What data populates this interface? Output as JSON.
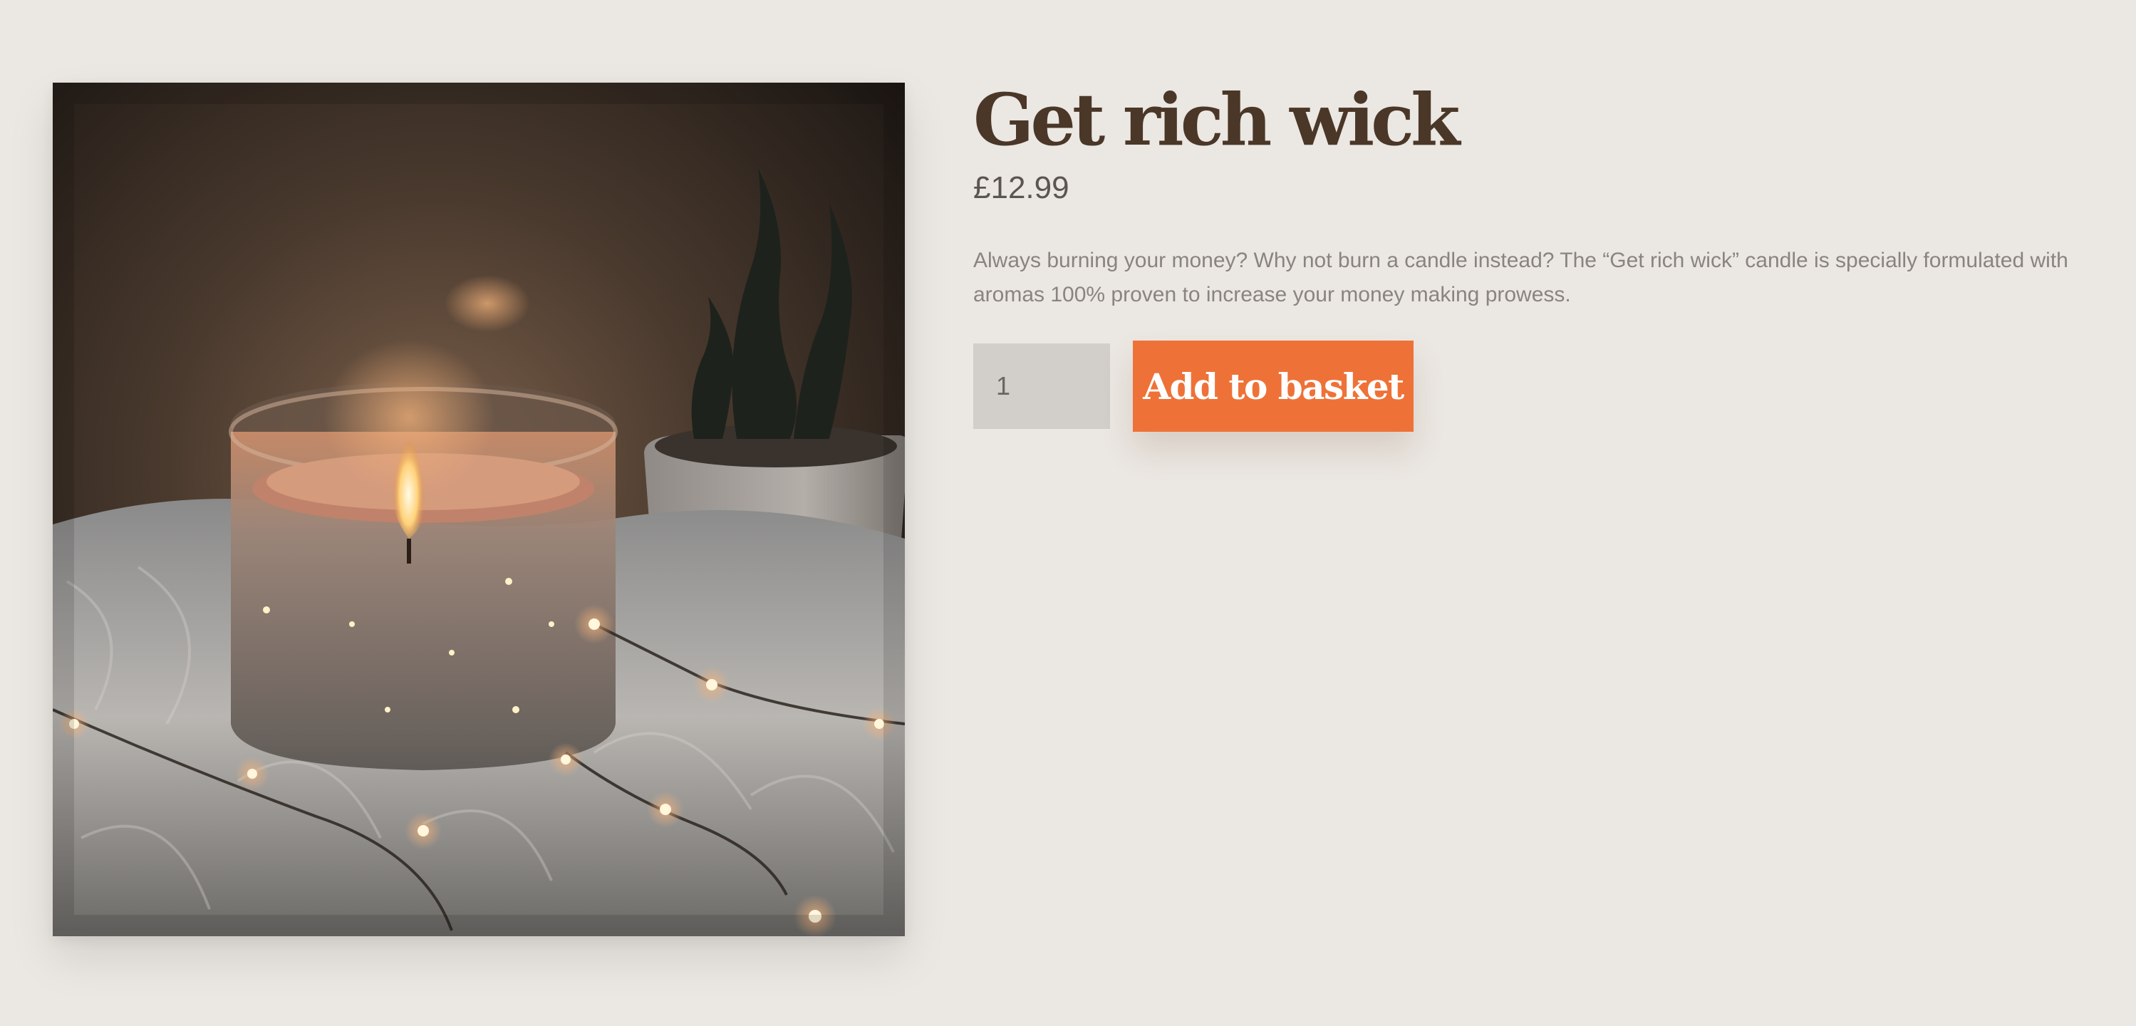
{
  "product": {
    "image_alt": "Lit candle in a glass jar on faux fur with fairy lights and a small potted plant",
    "title": "Get rich wick",
    "price": "£12.99",
    "description": "Always burning your money? Why not burn a candle instead? The “Get rich wick” candle is specially formulated with aromas 100% proven to increase your money making prowess."
  },
  "purchase": {
    "quantity_value": "1",
    "add_to_basket_label": "Add to basket"
  },
  "colors": {
    "page_background": "#ebe7e2",
    "title": "#4a3728",
    "button": "#ee7238"
  }
}
